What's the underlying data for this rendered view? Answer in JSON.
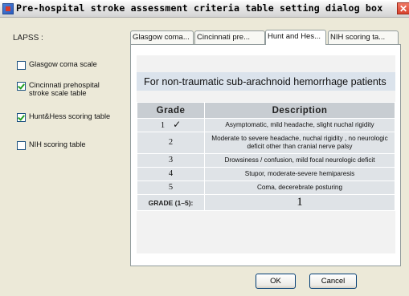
{
  "window": {
    "title": "Pre-hospital stroke assessment criteria table setting dialog box",
    "close_glyph": "✕"
  },
  "left": {
    "group_label": "LAPSS :",
    "options": [
      {
        "label": "Glasgow coma scale",
        "checked": false
      },
      {
        "label": "Cincinnati prehospital stroke scale table",
        "checked": true
      },
      {
        "label": "Hunt&Hess scoring table",
        "checked": true
      },
      {
        "label": "NIH scoring table",
        "checked": false
      }
    ]
  },
  "tabs": [
    {
      "label": "Glasgow coma...",
      "active": false
    },
    {
      "label": "Cincinnati pre...",
      "active": false
    },
    {
      "label": "Hunt and Hes...",
      "active": true
    },
    {
      "label": "NIH scoring ta...",
      "active": false
    }
  ],
  "hunt_hess": {
    "heading": "For non-traumatic sub-arachnoid hemorrhage patients",
    "columns": [
      "Grade",
      "Description"
    ],
    "rows": [
      {
        "grade": "1",
        "description": "Asymptomatic, mild headache, slight nuchal rigidity",
        "selected": true
      },
      {
        "grade": "2",
        "description": "Moderate to severe headache, nuchal rigidity , no neurologic deficit other than cranial nerve palsy",
        "selected": false
      },
      {
        "grade": "3",
        "description": "Drowsiness / confusion, mild focal neurologic deficit",
        "selected": false
      },
      {
        "grade": "4",
        "description": "Stupor, moderate-severe hemiparesis",
        "selected": false
      },
      {
        "grade": "5",
        "description": "Coma, decerebrate posturing",
        "selected": false
      }
    ],
    "check_glyph": "✓",
    "grade_label": "GRADE (1–5):",
    "grade_value": "1"
  },
  "buttons": {
    "ok": "OK",
    "cancel": "Cancel"
  },
  "colors": {
    "dialog_bg": "#ece9d8",
    "heading_bg": "#dbe3ec",
    "table_header_bg": "#c8cdd2",
    "table_row_bg": "#dfe3e7",
    "checkmark": "#21a121",
    "close_button": "#d8412d"
  }
}
